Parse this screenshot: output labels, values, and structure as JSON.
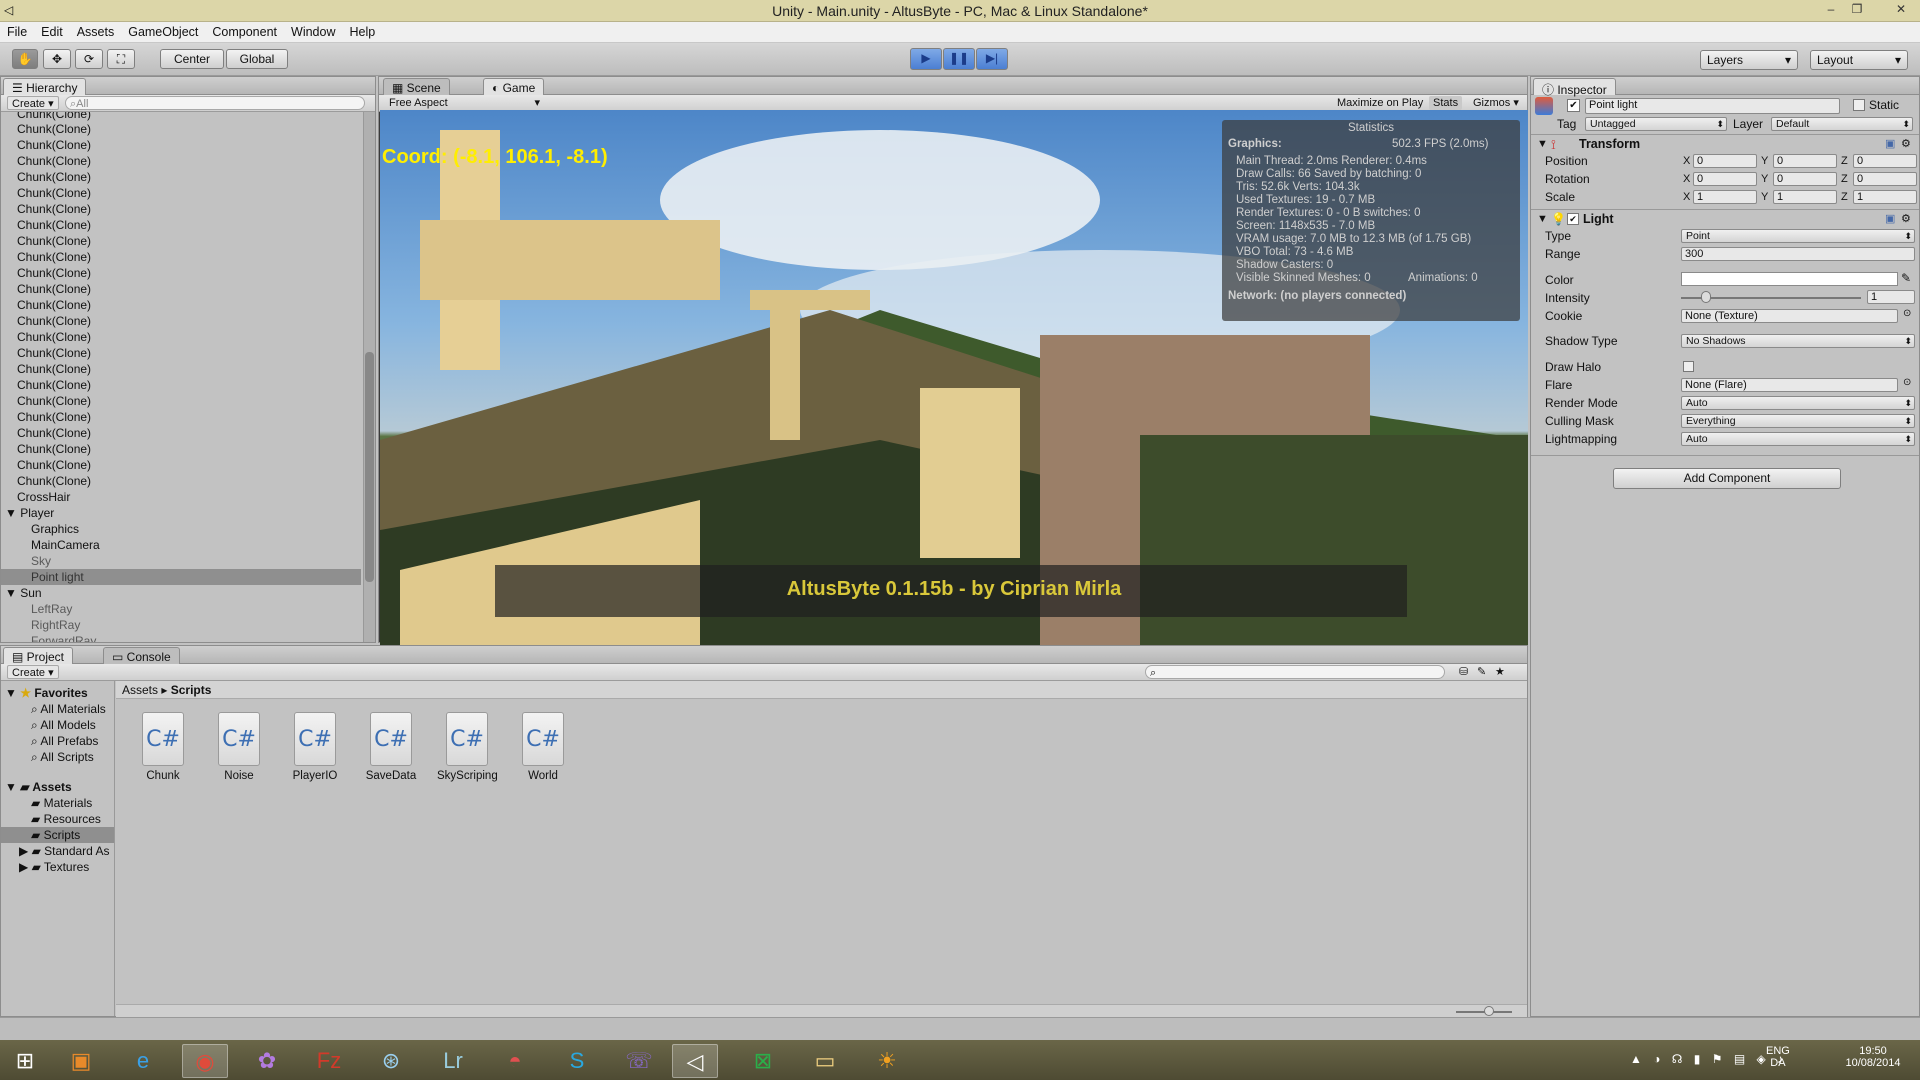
{
  "window": {
    "title": "Unity - Main.unity - AltusByte - PC, Mac & Linux Standalone*",
    "min": "–",
    "max": "❐",
    "close": "✕"
  },
  "menu": [
    "File",
    "Edit",
    "Assets",
    "GameObject",
    "Component",
    "Window",
    "Help"
  ],
  "toolbar": {
    "center": "Center",
    "global": "Global",
    "layers": "Layers",
    "layout": "Layout"
  },
  "hierarchy": {
    "tab": "Hierarchy",
    "create": "Create",
    "search_placeholder": "All",
    "items": [
      "Chunk(Clone)",
      "Chunk(Clone)",
      "Chunk(Clone)",
      "Chunk(Clone)",
      "Chunk(Clone)",
      "Chunk(Clone)",
      "Chunk(Clone)",
      "Chunk(Clone)",
      "Chunk(Clone)",
      "Chunk(Clone)",
      "Chunk(Clone)",
      "Chunk(Clone)",
      "Chunk(Clone)",
      "Chunk(Clone)",
      "Chunk(Clone)",
      "Chunk(Clone)",
      "Chunk(Clone)",
      "Chunk(Clone)",
      "Chunk(Clone)",
      "Chunk(Clone)",
      "Chunk(Clone)",
      "Chunk(Clone)",
      "Chunk(Clone)",
      "Chunk(Clone)"
    ],
    "crosshair": "CrossHair",
    "player": "Player",
    "graphics": "Graphics",
    "maincamera": "MainCamera",
    "sky": "Sky",
    "pointlight": "Point light",
    "sun": "Sun",
    "leftray": "LeftRay",
    "rightray": "RightRay",
    "forwardray": "ForwardRay"
  },
  "scene": {
    "tab_scene": "Scene",
    "tab_game": "Game",
    "aspect": "Free Aspect",
    "maximize": "Maximize on Play",
    "stats": "Stats",
    "gizmos": "Gizmos"
  },
  "game": {
    "coord": "Coord: (-8.1, 106.1, -8.1)",
    "banner": "AltusByte 0.1.15b - by Ciprian Mirla"
  },
  "statistics": {
    "title": "Statistics",
    "graphics": "Graphics:",
    "fps": "502.3 FPS (2.0ms)",
    "l1": "Main Thread: 2.0ms  Renderer: 0.4ms",
    "l2": "Draw Calls: 66    Saved by batching: 0",
    "l3": "Tris: 52.6k  Verts: 104.3k",
    "l4": "Used Textures: 19 - 0.7 MB",
    "l5": "Render Textures: 0 - 0 B  switches: 0",
    "l6": "Screen: 1148x535 - 7.0 MB",
    "l7": "VRAM usage: 7.0 MB to 12.3 MB (of 1.75 GB)",
    "l8": "VBO Total: 73 - 4.6 MB",
    "l9": "Shadow Casters: 0",
    "l10": "Visible Skinned Meshes: 0",
    "l10b": "Animations: 0",
    "network": "Network: (no players connected)"
  },
  "inspector": {
    "tab": "Inspector",
    "name": "Point light",
    "static": "Static",
    "tag_label": "Tag",
    "tag": "Untagged",
    "layer_label": "Layer",
    "layer": "Default",
    "transform": "Transform",
    "position": "Position",
    "rotation": "Rotation",
    "scale": "Scale",
    "pos": [
      "0",
      "0",
      "0"
    ],
    "rot": [
      "0",
      "0",
      "0"
    ],
    "scl": [
      "1",
      "1",
      "1"
    ],
    "light": "Light",
    "type_label": "Type",
    "type": "Point",
    "range_label": "Range",
    "range": "300",
    "color_label": "Color",
    "intensity_label": "Intensity",
    "intensity": "1",
    "cookie_label": "Cookie",
    "cookie": "None (Texture)",
    "shadow_label": "Shadow Type",
    "shadow": "No Shadows",
    "halo_label": "Draw Halo",
    "flare_label": "Flare",
    "flare": "None (Flare)",
    "render_label": "Render Mode",
    "render": "Auto",
    "culling_label": "Culling Mask",
    "culling": "Everything",
    "lightmap_label": "Lightmapping",
    "lightmap": "Auto",
    "add": "Add Component",
    "x": "X",
    "y": "Y",
    "z": "Z"
  },
  "project": {
    "tab_project": "Project",
    "tab_console": "Console",
    "create": "Create",
    "favorites": "Favorites",
    "fav": [
      "All Materials",
      "All Models",
      "All Prefabs",
      "All Scripts"
    ],
    "assets": "Assets",
    "folders": [
      "Materials",
      "Resources",
      "Scripts",
      "Standard As",
      "Textures"
    ],
    "crumb1": "Assets",
    "crumb2": "Scripts",
    "files": [
      "Chunk",
      "Noise",
      "PlayerIO",
      "SaveData",
      "SkyScriping",
      "World"
    ]
  },
  "taskbar": {
    "lang1": "ENG",
    "lang2": "DA",
    "time": "19:50",
    "date": "10/08/2014"
  }
}
